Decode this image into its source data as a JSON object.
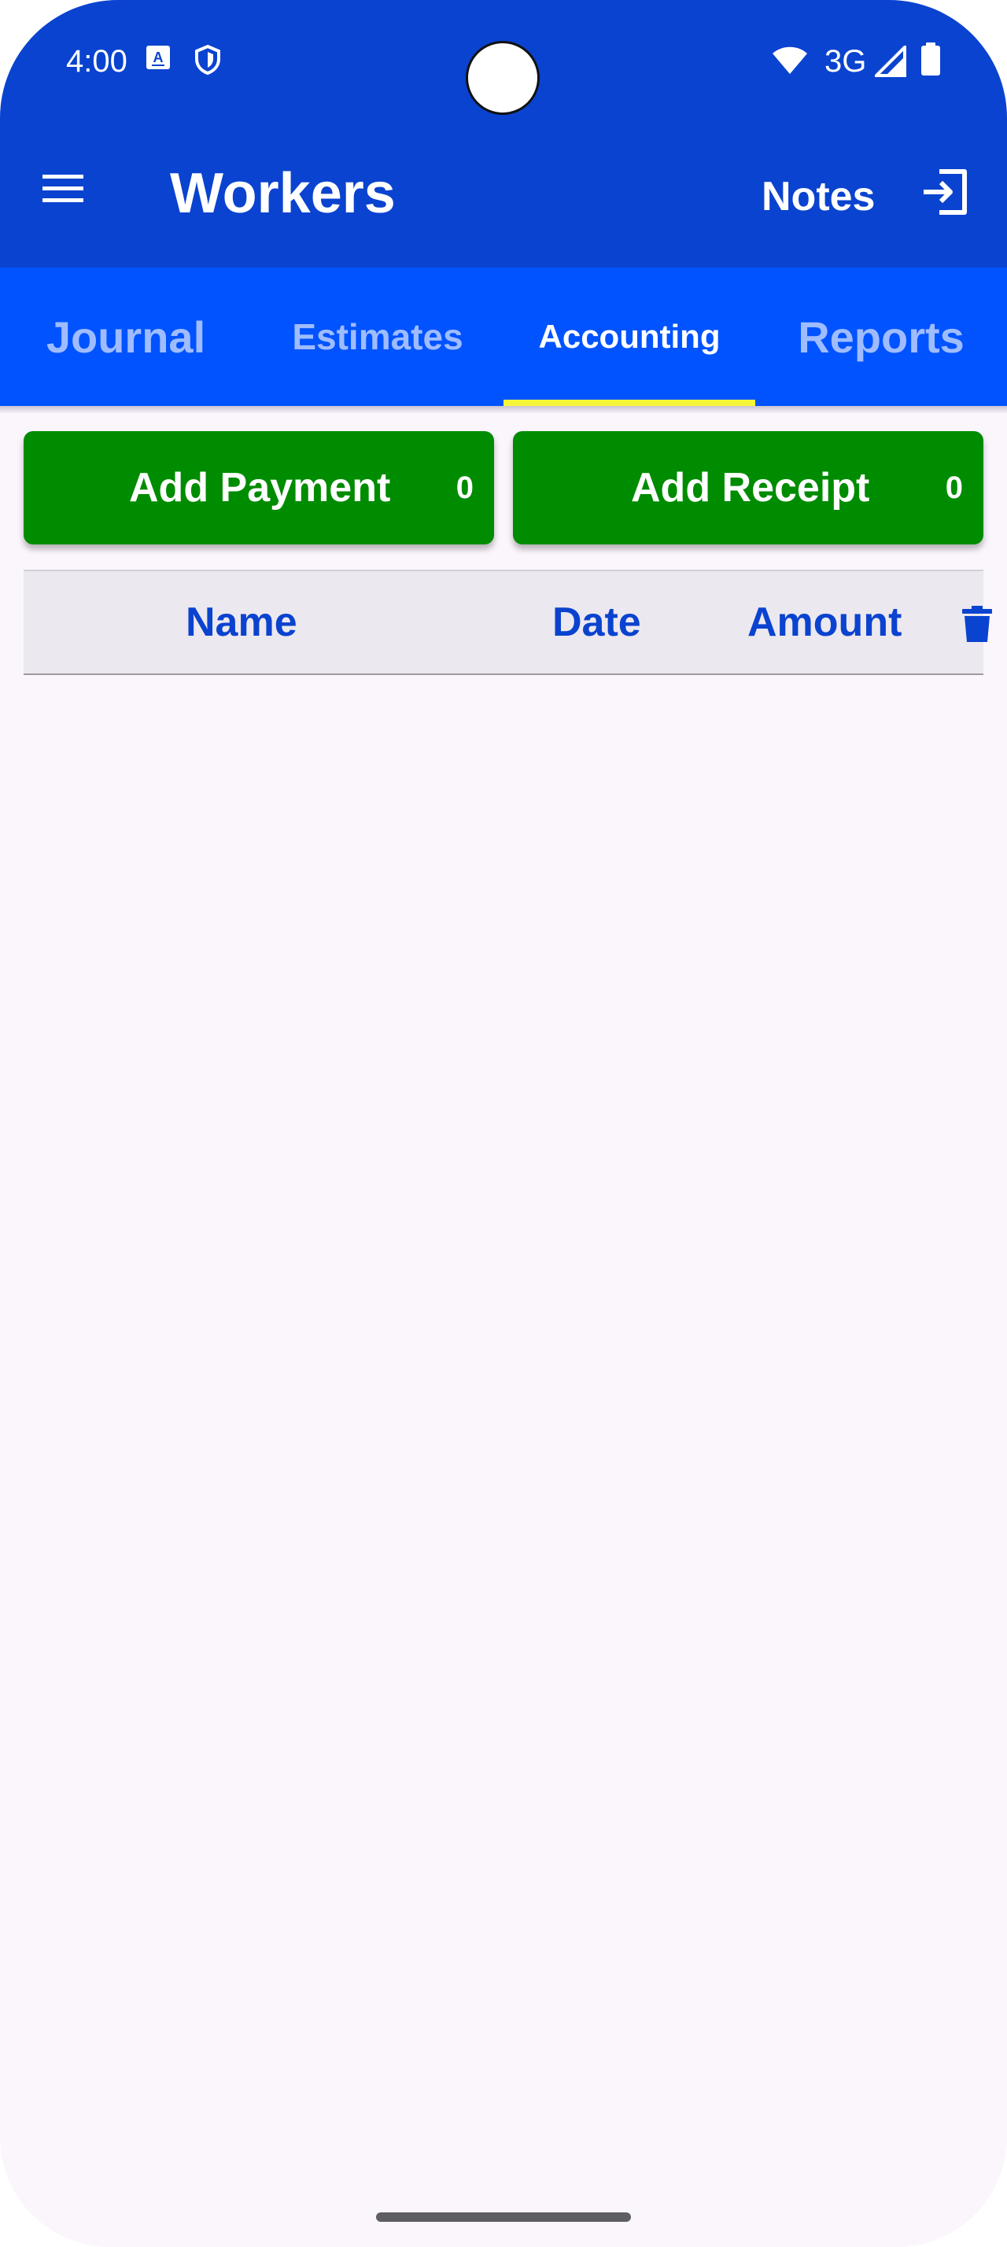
{
  "status_bar": {
    "time": "4:00",
    "network": "3G",
    "icons": [
      "keyboard-a-icon",
      "shield-icon",
      "wifi-icon",
      "signal-icon",
      "battery-icon"
    ]
  },
  "app_bar": {
    "title": "Workers",
    "notes_label": "Notes",
    "icons": [
      "menu-icon",
      "logout-icon"
    ]
  },
  "tabs": [
    {
      "label": "Journal",
      "active": false
    },
    {
      "label": "Estimates",
      "active": false
    },
    {
      "label": "Accounting",
      "active": true
    },
    {
      "label": "Reports",
      "active": false
    }
  ],
  "actions": {
    "add_payment": {
      "label": "Add Payment",
      "count": "0"
    },
    "add_receipt": {
      "label": "Add Receipt",
      "count": "0"
    }
  },
  "table": {
    "columns": [
      "Name",
      "Date",
      "Amount"
    ],
    "rows": [],
    "delete_icon": "trash-icon"
  },
  "colors": {
    "app_bar": "#0a43cf",
    "tab_bar": "#0053ff",
    "tab_indicator": "#f5f53a",
    "action_button": "#008c00",
    "header_text": "#0a43cf",
    "background": "#fbf5fc"
  }
}
